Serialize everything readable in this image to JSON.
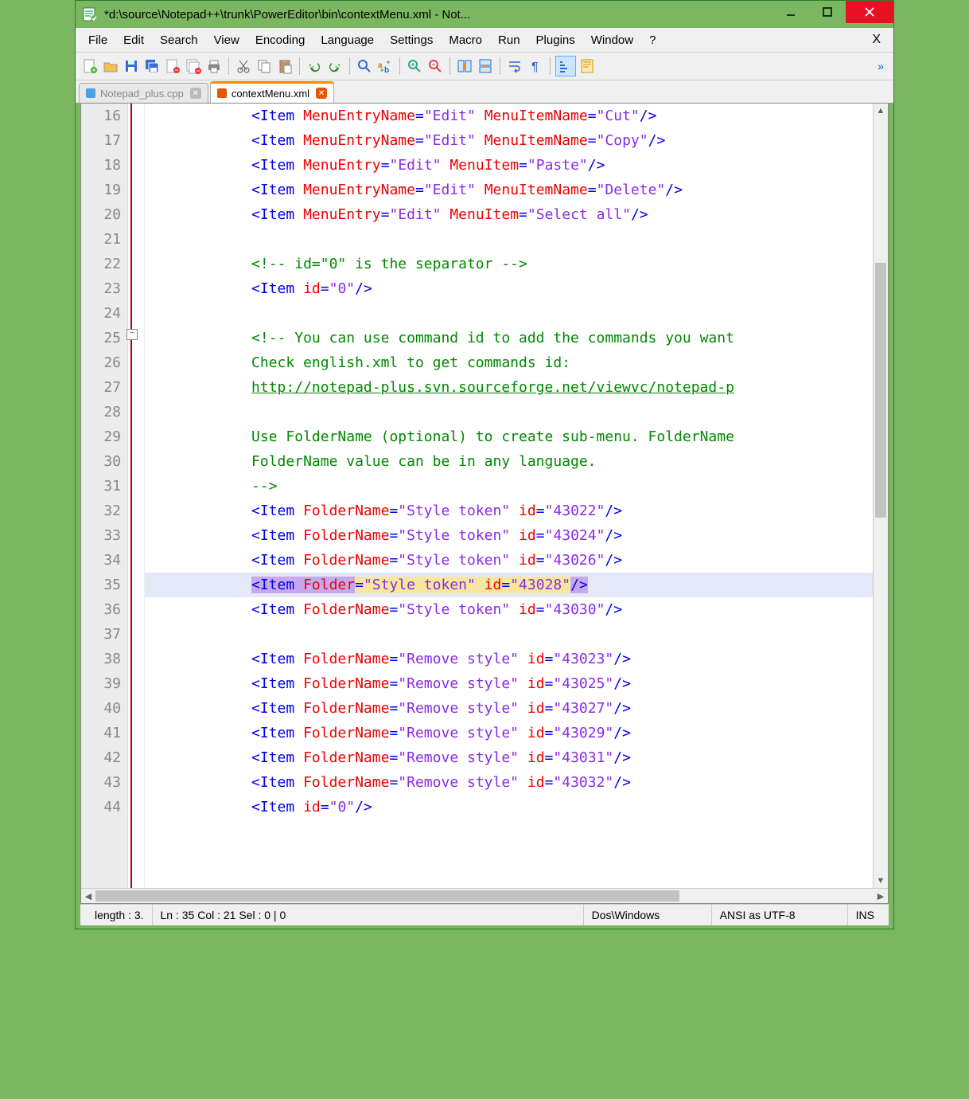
{
  "window": {
    "title": "*d:\\source\\Notepad++\\trunk\\PowerEditor\\bin\\contextMenu.xml - Not..."
  },
  "menu": {
    "items": [
      "File",
      "Edit",
      "Search",
      "View",
      "Encoding",
      "Language",
      "Settings",
      "Macro",
      "Run",
      "Plugins",
      "Window",
      "?"
    ],
    "close_x": "X"
  },
  "tabs": {
    "inactive": "Notepad_plus.cpp",
    "active": "contextMenu.xml"
  },
  "gutter": {
    "start": 16,
    "end": 44
  },
  "code_lines": [
    {
      "n": 16,
      "t": "item",
      "attr": "MenuEntryName",
      "v1": "Edit",
      "attr2": "MenuItemName",
      "v2": "Cut"
    },
    {
      "n": 17,
      "t": "item",
      "attr": "MenuEntryName",
      "v1": "Edit",
      "attr2": "MenuItemName",
      "v2": "Copy"
    },
    {
      "n": 18,
      "t": "item",
      "attr": "MenuEntry",
      "v1": "Edit",
      "attr2": "MenuItem",
      "v2": "Paste",
      "cursor": true
    },
    {
      "n": 19,
      "t": "item",
      "attr": "MenuEntryName",
      "v1": "Edit",
      "attr2": "MenuItemName",
      "v2": "Delete"
    },
    {
      "n": 20,
      "t": "item",
      "attr": "MenuEntry",
      "v1": "Edit",
      "attr2": "MenuItem",
      "v2": "Select all"
    },
    {
      "n": 21,
      "t": "blank"
    },
    {
      "n": 22,
      "t": "cmt",
      "text": "<!-- id=\"0\" is the separator -->"
    },
    {
      "n": 23,
      "t": "itemid",
      "id": "0"
    },
    {
      "n": 24,
      "t": "blank"
    },
    {
      "n": 25,
      "t": "cmt",
      "text": "<!-- You can use command id to add the commands you want"
    },
    {
      "n": 26,
      "t": "cmt",
      "text": "Check english.xml to get commands id:"
    },
    {
      "n": 27,
      "t": "link",
      "text": "http://notepad-plus.svn.sourceforge.net/viewvc/notepad-p"
    },
    {
      "n": 28,
      "t": "blank_cmt"
    },
    {
      "n": 29,
      "t": "cmt",
      "text": "Use FolderName (optional) to create sub-menu. FolderName"
    },
    {
      "n": 30,
      "t": "cmt",
      "text": "FolderName value can be in any language."
    },
    {
      "n": 31,
      "t": "cmt",
      "text": "-->"
    },
    {
      "n": 32,
      "t": "folder",
      "fn": "FolderName",
      "fv": "Style token",
      "id": "43022"
    },
    {
      "n": 33,
      "t": "folder",
      "fn": "FolderName",
      "fv": "Style token",
      "id": "43024"
    },
    {
      "n": 34,
      "t": "folder",
      "fn": "FolderName",
      "fv": "Style token",
      "id": "43026"
    },
    {
      "n": 35,
      "t": "folder_hl",
      "fn": "Folder",
      "fv": "Style token",
      "id": "43028"
    },
    {
      "n": 36,
      "t": "folder",
      "fn": "FolderName",
      "fv": "Style token",
      "id": "43030"
    },
    {
      "n": 37,
      "t": "blank"
    },
    {
      "n": 38,
      "t": "folder",
      "fn": "FolderName",
      "fv": "Remove style",
      "id": "43023"
    },
    {
      "n": 39,
      "t": "folder",
      "fn": "FolderName",
      "fv": "Remove style",
      "id": "43025"
    },
    {
      "n": 40,
      "t": "folder",
      "fn": "FolderName",
      "fv": "Remove style",
      "id": "43027"
    },
    {
      "n": 41,
      "t": "folder",
      "fn": "FolderName",
      "fv": "Remove style",
      "id": "43029"
    },
    {
      "n": 42,
      "t": "folder",
      "fn": "FolderName",
      "fv": "Remove style",
      "id": "43031"
    },
    {
      "n": 43,
      "t": "folder",
      "fn": "FolderName",
      "fv": "Remove style",
      "id": "43032"
    },
    {
      "n": 44,
      "t": "itemid",
      "id": "0"
    }
  ],
  "status": {
    "length": "length : 3.",
    "pos": "Ln : 35    Col : 21    Sel : 0 | 0",
    "eol": "Dos\\Windows",
    "enc": "ANSI as UTF-8",
    "mode": "INS"
  },
  "icons": {
    "toolbar": [
      "new",
      "open",
      "save",
      "save-all",
      "close",
      "close-all",
      "print",
      "cut",
      "copy",
      "paste",
      "undo",
      "redo",
      "find",
      "replace",
      "zoom-in",
      "zoom-out",
      "sync-v",
      "sync-h",
      "wrap",
      "show-all",
      "indent-guide",
      "doc-map"
    ]
  }
}
